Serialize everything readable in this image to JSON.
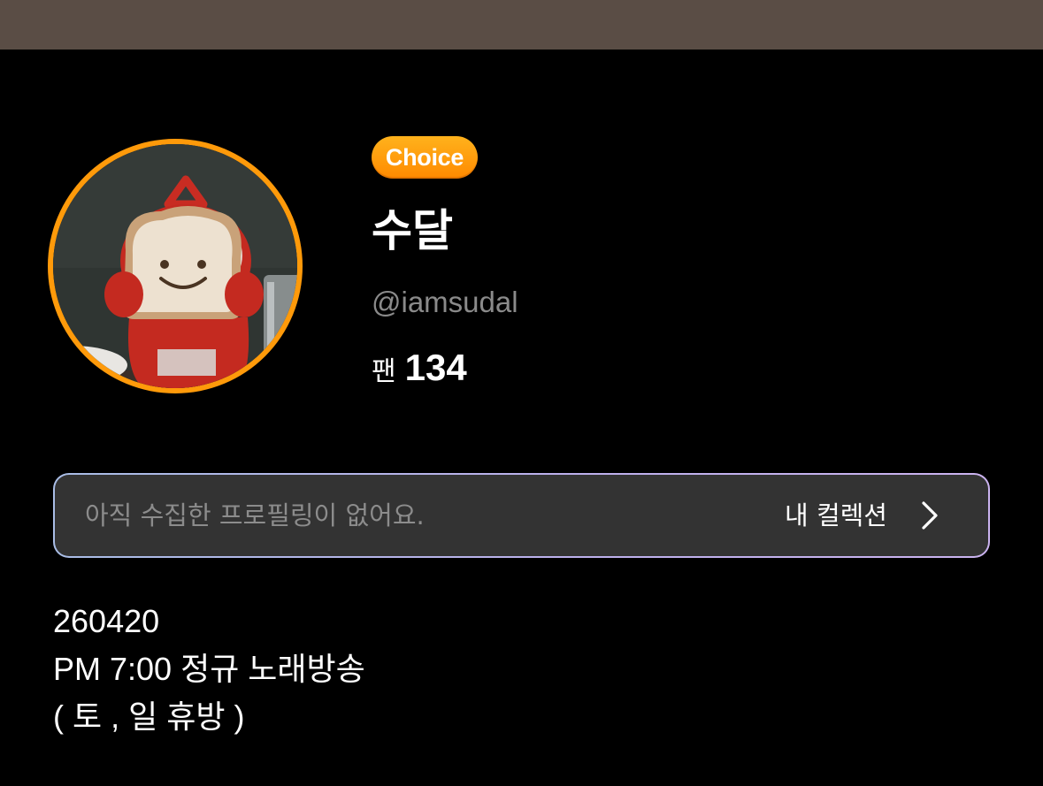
{
  "profile": {
    "badge": "Choice",
    "name": "수달",
    "handle": "@iamsudal",
    "fans_label": "팬",
    "fans_count": "134",
    "avatar_icon": "avatar-photo"
  },
  "collection": {
    "empty_text": "아직 수집한 프로필링이 없어요.",
    "link_label": "내 컬렉션",
    "icon": "chevron-right-icon"
  },
  "bio": {
    "line1": "260420",
    "line2": "PM 7:00 정규 노래방송",
    "line3": "( 토 , 일 휴방 )"
  },
  "colors": {
    "accent_orange": "#ff9a0a",
    "background": "#000000",
    "header_strip": "#5a4d45",
    "card_background": "#333333",
    "card_border_start": "#a9bde6",
    "card_border_end": "#cbb3f0",
    "muted_text": "#8a8a8a"
  }
}
